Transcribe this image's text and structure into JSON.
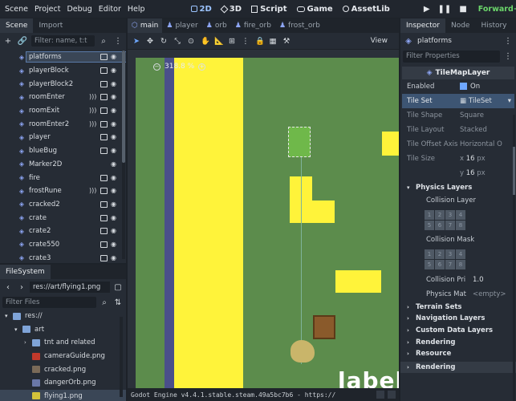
{
  "menubar": {
    "menus": [
      "Scene",
      "Project",
      "Debug",
      "Editor",
      "Help"
    ],
    "workspaces": [
      {
        "label": "2D",
        "active": true
      },
      {
        "label": "3D",
        "active": false
      },
      {
        "label": "Script",
        "active": false
      },
      {
        "label": "Game",
        "active": false
      },
      {
        "label": "AssetLib",
        "active": false
      }
    ],
    "renderer": "Forward+"
  },
  "scene_dock": {
    "tabs": [
      "Scene",
      "Import"
    ],
    "filter_placeholder": "Filter: name, t:t",
    "nodes": [
      {
        "label": "platforms",
        "selected": true,
        "icon_color": "#8da5f3",
        "script": true,
        "signal": false
      },
      {
        "label": "playerBlock",
        "selected": false,
        "icon_color": "#8da5f3",
        "script": true,
        "signal": false
      },
      {
        "label": "playerBlock2",
        "selected": false,
        "icon_color": "#8da5f3",
        "script": true,
        "signal": false
      },
      {
        "label": "roomEnter",
        "selected": false,
        "icon_color": "#8da5f3",
        "script": true,
        "signal": true
      },
      {
        "label": "roomExit",
        "selected": false,
        "icon_color": "#8da5f3",
        "script": true,
        "signal": true
      },
      {
        "label": "roomEnter2",
        "selected": false,
        "icon_color": "#8da5f3",
        "script": true,
        "signal": true
      },
      {
        "label": "player",
        "selected": false,
        "icon_color": "#8da5f3",
        "script": true,
        "signal": false
      },
      {
        "label": "blueBug",
        "selected": false,
        "icon_color": "#8da5f3",
        "script": true,
        "signal": false
      },
      {
        "label": "Marker2D",
        "selected": false,
        "icon_color": "#8da5f3",
        "script": false,
        "signal": false
      },
      {
        "label": "fire",
        "selected": false,
        "icon_color": "#8da5f3",
        "script": true,
        "signal": false
      },
      {
        "label": "frostRune",
        "selected": false,
        "icon_color": "#8da5f3",
        "script": true,
        "signal": true
      },
      {
        "label": "cracked2",
        "selected": false,
        "icon_color": "#8da5f3",
        "script": true,
        "signal": false
      },
      {
        "label": "crate",
        "selected": false,
        "icon_color": "#8da5f3",
        "script": true,
        "signal": false
      },
      {
        "label": "crate2",
        "selected": false,
        "icon_color": "#8da5f3",
        "script": true,
        "signal": false
      },
      {
        "label": "crate550",
        "selected": false,
        "icon_color": "#8da5f3",
        "script": true,
        "signal": false
      },
      {
        "label": "crate3",
        "selected": false,
        "icon_color": "#8da5f3",
        "script": true,
        "signal": false
      }
    ]
  },
  "filesystem": {
    "tab": "FileSystem",
    "path": "res://art/flying1.png",
    "filter_placeholder": "Filter Files",
    "items": [
      {
        "label": "res://",
        "indent": 0,
        "kind": "folder",
        "color": "#7fa4d8",
        "selected": false
      },
      {
        "label": "art",
        "indent": 1,
        "kind": "folder",
        "color": "#7fa4d8",
        "selected": false
      },
      {
        "label": "tnt and related",
        "indent": 2,
        "kind": "folder",
        "color": "#7fa4d8",
        "selected": false
      },
      {
        "label": "cameraGuide.png",
        "indent": 2,
        "kind": "file",
        "color": "#c0392b",
        "selected": false
      },
      {
        "label": "cracked.png",
        "indent": 2,
        "kind": "file",
        "color": "#7a6a58",
        "selected": false
      },
      {
        "label": "dangerOrb.png",
        "indent": 2,
        "kind": "file",
        "color": "#6a78a8",
        "selected": false
      },
      {
        "label": "flying1.png",
        "indent": 2,
        "kind": "file",
        "color": "#d4c23a",
        "selected": true
      }
    ]
  },
  "editor": {
    "tabs": [
      {
        "label": "main",
        "active": true
      },
      {
        "label": "player",
        "active": false
      },
      {
        "label": "orb",
        "active": false
      },
      {
        "label": "fire_orb",
        "active": false
      },
      {
        "label": "frost_orb",
        "active": false
      }
    ],
    "view_menu": "View",
    "zoom_level": "318.8 %",
    "viewport_label": "label",
    "output_text": "Godot Engine v4.4.1.stable.steam.49a5bc7b6 - https://"
  },
  "inspector": {
    "tabs": [
      "Inspector",
      "Node",
      "History"
    ],
    "object_name": "platforms",
    "filter_placeholder": "Filter Properties",
    "class_name": "TileMapLayer",
    "props": {
      "enabled": {
        "name": "Enabled",
        "value": "On"
      },
      "tile_set": {
        "name": "Tile Set",
        "value": "TileSet"
      },
      "tile_shape": {
        "name": "Tile Shape",
        "value": "Square"
      },
      "tile_layout": {
        "name": "Tile Layout",
        "value": "Stacked"
      },
      "tile_offset_axis": {
        "name": "Tile Offset Axis",
        "value": "Horizontal O"
      },
      "tile_size": {
        "name": "Tile Size",
        "x_label": "x",
        "x": "16",
        "y_label": "y",
        "y": "16",
        "unit": "px"
      }
    },
    "physics_layers": {
      "title": "Physics Layers",
      "collision_layer": "Collision Layer",
      "collision_mask": "Collision Mask",
      "collision_priority": {
        "name": "Collision Pri",
        "value": "1.0"
      },
      "physics_material": {
        "name": "Physics Mat",
        "value": "<empty>"
      },
      "cells": [
        "1",
        "2",
        "3",
        "4",
        "5",
        "6",
        "7",
        "8"
      ]
    },
    "sections": [
      "Terrain Sets",
      "Navigation Layers",
      "Custom Data Layers",
      "Rendering",
      "Resource"
    ],
    "bottom_section": "Rendering"
  },
  "colors": {
    "accent": "#6ea7ff",
    "level_green": "#5c8c4c",
    "platform_yellow": "#fff33a",
    "renderer_green": "#6bd66b"
  }
}
